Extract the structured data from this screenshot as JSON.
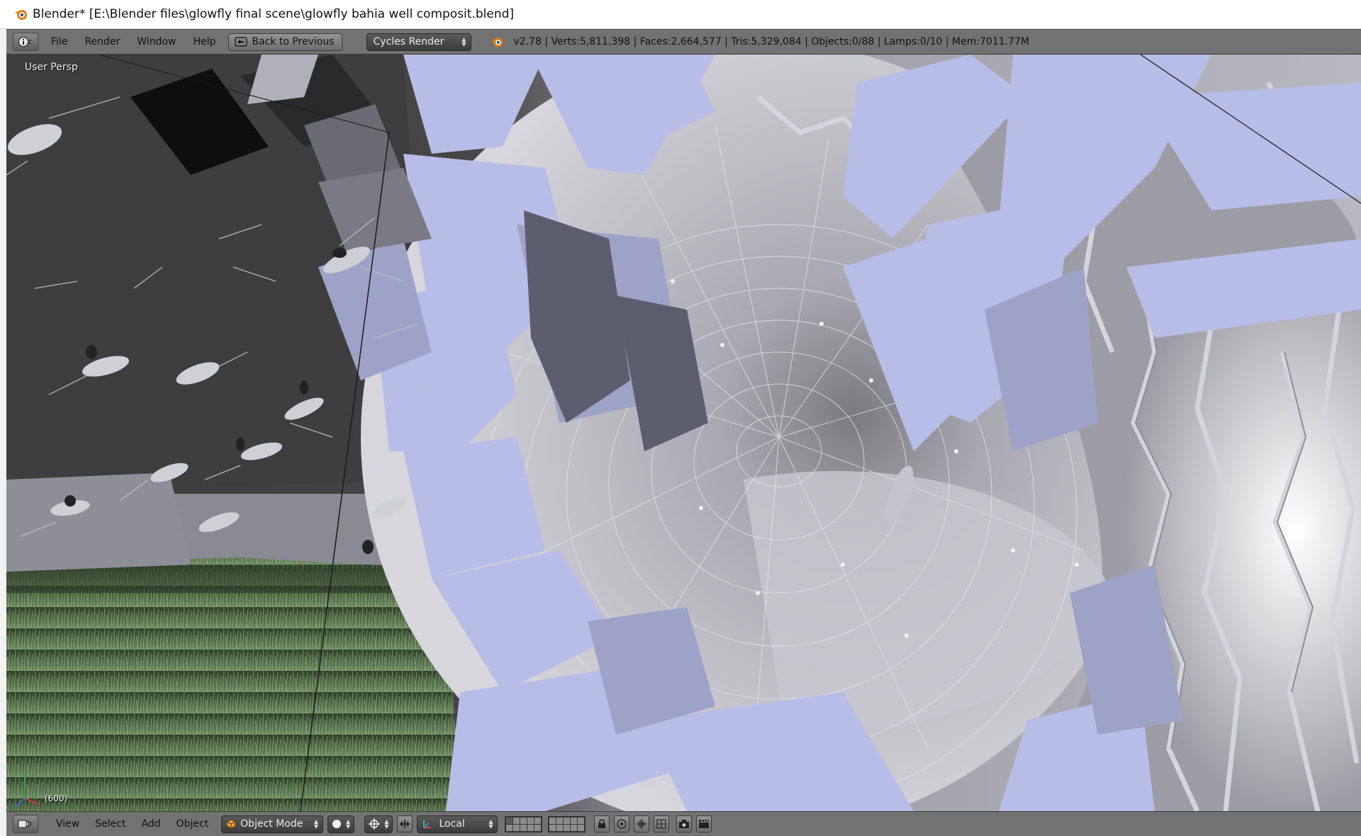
{
  "window": {
    "title": "Blender* [E:\\Blender files\\glowfly final scene\\glowfly bahia well composit.blend]",
    "icon": "blender-logo-icon"
  },
  "info_header": {
    "menus": [
      "File",
      "Render",
      "Window",
      "Help"
    ],
    "back_button": "Back to Previous",
    "render_engine": "Cycles Render",
    "stats": "v2.78 | Verts:5,811,398 | Faces:2,664,577 | Tris:5,329,084 | Objects:0/88 | Lamps:0/10 | Mem:7011.77M"
  },
  "viewport": {
    "view_label": "User Persp",
    "frame_label": "(600)"
  },
  "view3d_header": {
    "menus": [
      "View",
      "Select",
      "Add",
      "Object"
    ],
    "mode": "Object Mode",
    "orientation": "Local"
  },
  "colors": {
    "header_bg": "#727272",
    "select_bg": "#4a4a4a",
    "solid_light": "#b0b8e0",
    "background_dark": "#3c3c3c",
    "grass": "#3e5a36"
  }
}
